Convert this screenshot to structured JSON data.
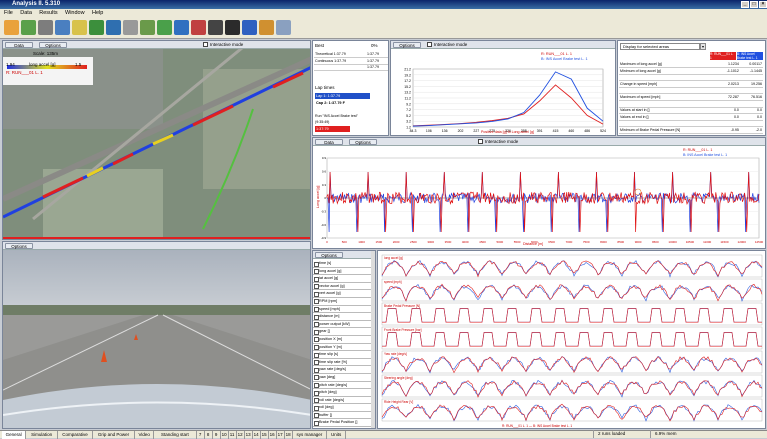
{
  "window": {
    "title": "Analysis  II. 5.310"
  },
  "menu": [
    "File",
    "Data",
    "Results",
    "Window",
    "Help"
  ],
  "map": {
    "data_label": "Data",
    "options_label": "Options",
    "interactive_label": "Interactive mode",
    "scale_label": "Scale: 135m",
    "legend": [
      "1.94",
      "long accel [g]",
      "1.5"
    ],
    "notes": "R: RUN___01 L. 1"
  },
  "laps": {
    "best_label": "Best",
    "pct_label": "0%",
    "rows": [
      {
        "name": "Theoretical 1:37.79",
        "val": "1:37.79"
      },
      {
        "name": "Continuous 1:37.79",
        "val": "1:37.79"
      },
      {
        "name": "",
        "val": "1:37.79"
      }
    ],
    "lap_times_label": "Lap times",
    "sel1": "Lap 1: 1:37.79",
    "sel2": "Cap 2: 1:37.79 F",
    "run_note": "Run \"INS Accel Brake test\"",
    "run_date": "(9:35:49)",
    "blue_label": "1:37:79"
  },
  "hist": {
    "options_label": "Options",
    "interactive_label": "Interactive mode",
    "legend": [
      "R: RUN___01 L. 1",
      "B: INS Accel Brake test L. 1"
    ],
    "xlabel": "Positive data [g] fo Long accel [g]",
    "chart_data": {
      "type": "line",
      "x": [
        84.3,
        106,
        136,
        202,
        227,
        275,
        326,
        358,
        391,
        415,
        460,
        486,
        524
      ],
      "y_ticks": [
        21.2,
        19.2,
        17.2,
        15.2,
        13.2,
        11.2,
        9.2,
        7.2,
        5.2,
        3.2,
        1.2
      ],
      "series": [
        {
          "name": "R: RUN___01 L. 1",
          "color": "#e02020",
          "values": [
            0.4,
            0.6,
            0.9,
            1.2,
            1.6,
            2.2,
            3.0,
            4.5,
            9.0,
            14.5,
            10.0,
            4.0,
            1.0
          ]
        },
        {
          "name": "B: INS Accel Brake test L. 1",
          "color": "#2050e0",
          "values": [
            0.3,
            0.5,
            0.8,
            1.1,
            1.4,
            1.9,
            2.8,
            5.0,
            11.0,
            19.0,
            16.5,
            6.5,
            2.0
          ]
        }
      ]
    }
  },
  "stats": {
    "title": "Display for selected areas",
    "col_red": "R: RUN___01 L. 1",
    "col_blue": "B: INS Accel Brake test L. 1",
    "rows": [
      [
        "Maximum of long accel [g]",
        "1.1234",
        "0.00117"
      ],
      [
        "Minimum of long accel [g]",
        "-1.1012",
        "-1.1445"
      ],
      [
        "",
        "",
        " "
      ],
      [
        "Change in speed [mph]",
        "2.0213",
        "19.256"
      ],
      [
        "",
        "",
        " "
      ],
      [
        "Maximum of speed [mph]",
        "72.287",
        "76.516"
      ],
      [
        "",
        "",
        " "
      ],
      [
        "Values at start in []",
        "0.0",
        "0.0"
      ],
      [
        "Values at end in []",
        "0.0",
        "0.0"
      ],
      [
        "",
        "",
        " "
      ],
      [
        "Minimum of Brake Pedal Pressure [N]",
        "-0.95",
        "-2.0"
      ],
      [
        "Maximum of Brake Pedal Pressure [N]",
        "565.95",
        "739.25"
      ],
      [
        "Maximum of Throttle position []",
        "0.0",
        "0.0"
      ],
      [
        "Minimum of Throttle position []",
        "81.",
        "94."
      ]
    ]
  },
  "trace": {
    "data_label": "Data",
    "options_label": "Options",
    "interactive_label": "Interactive mode",
    "legend": [
      "R: RUN___01 L. 1",
      "B: INS Accel Brake test L. 1"
    ],
    "ylabel": "Long accel [g]",
    "xlabel": "Distance [m]",
    "chart_data": {
      "type": "line",
      "x_ticks": [
        0,
        500,
        1000,
        1500,
        2000,
        2500,
        3000,
        3500,
        4000,
        4500,
        5000,
        5500,
        6000,
        6500,
        7000,
        7500,
        8000,
        8500,
        9000,
        9500,
        10000,
        10500,
        11000,
        11500,
        12000,
        12500
      ],
      "y_ticks": [
        0.9,
        0.6,
        0.3,
        0.0,
        -0.3,
        -0.6,
        -0.9
      ],
      "series": [
        {
          "name": "R: RUN___01 L. 1",
          "color": "#e01010"
        },
        {
          "name": "B: INS Accel Brake test L. 1",
          "color": "#2040e0"
        }
      ]
    }
  },
  "video": {
    "options_label": "Options"
  },
  "channels": {
    "options_label": "Options",
    "items": [
      "time [s]",
      "long accel [g]",
      "lat accel [g]",
      "vector accel [g]",
      "vert accel [g]",
      "RPM [rpm]",
      "speed [mph]",
      "distance [m]",
      "power output [kW]",
      "gear []",
      "position X [m]",
      "position Y [m]",
      "time slip [s]",
      "time slip rate [%]",
      "yaw rate [deg/s]",
      "yaw [deg]",
      "pitch rate [deg/s]",
      "pitch [deg]",
      "roll rate [deg/s]",
      "roll [deg]",
      "buffer []",
      "Brake Pedal Position []",
      "Brake Pedal Pressure [N]",
      "Ride Height Rear [V]"
    ]
  },
  "strips": {
    "labels": [
      "long accel [g]",
      "speed [mph]",
      "Brake Pedal Pressure [N]",
      "Front Brake Pressure [bar]",
      "Yaw rate [deg/s]",
      "Steering angle [deg]",
      "Ride Height Rear [V]"
    ],
    "colors": {
      "red": "#e02020",
      "blue": "#3060e0"
    },
    "footer": "R: RUN___01 L. 1 — B: INS Accel Brake test L. 1"
  },
  "tabs": [
    "General",
    "Simulation",
    "Comparative",
    "Grip and Power",
    "Video",
    "Standing start",
    "7",
    "8",
    "9",
    "10",
    "11",
    "12",
    "13",
    "14",
    "15",
    "16",
    "17",
    "18",
    "sys manager",
    "Units"
  ],
  "status": {
    "runs": "2 runs loaded",
    "mem": "6.9% mem"
  }
}
